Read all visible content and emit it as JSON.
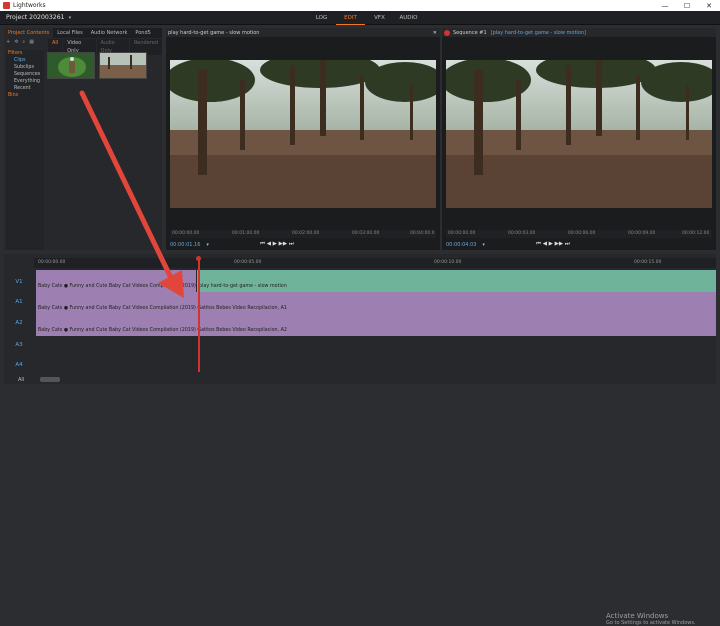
{
  "window": {
    "title": "Lightworks",
    "min": "—",
    "max": "☐",
    "close": "✕"
  },
  "project": {
    "name": "Project 202003261",
    "chevron": "▾"
  },
  "modes": [
    "LOG",
    "EDIT",
    "VFX",
    "AUDIO"
  ],
  "active_mode": "EDIT",
  "left": {
    "tabs": [
      "Project Contents",
      "Local Files",
      "Audio Network",
      "Pond5"
    ],
    "filters": [
      "All",
      "Video Only",
      "Audio Only",
      "Rendered"
    ],
    "tree": {
      "filters_label": "Filters",
      "items": [
        "Clips",
        "Subclips",
        "Sequences",
        "Everything",
        "Recent"
      ],
      "bins_label": "Bins"
    }
  },
  "viewer_left": {
    "title": "play hard-to-get game - slow motion",
    "close": "✕",
    "ruler": [
      "00:00:00.00",
      "00:01:00.00",
      "00:02:00.00",
      "00:03:00.00",
      "00:04:00.0"
    ],
    "timecode": "00:00:01.16",
    "dropdown": "▾"
  },
  "viewer_right": {
    "title": "Sequence #1",
    "subtitle": "[play hard-to-get game - slow motion]",
    "ruler": [
      "00:00:00.00",
      "00:00:03.00",
      "00:00:06.00",
      "00:00:09.00",
      "00:00:12.00"
    ],
    "timecode": "00:00:04.03",
    "dropdown": "▾"
  },
  "transport_glyphs": "⏮ ◀ ▶ ▶▶ ⏭",
  "timeline": {
    "ruler": [
      "00:00:00.00",
      "00:00:05.00",
      "00:00:10.00",
      "00:00:15.00"
    ],
    "tracks": [
      {
        "name": "V1",
        "label": "Baby Cats ● Funny and Cute Baby Cat Videos Compilation (2019) Gatitos B",
        "label2": "play hard-to-get game - slow motion",
        "color": "#9d7fb1",
        "color2": "#6fb39a"
      },
      {
        "name": "A1",
        "label": "Baby Cats ● Funny and Cute Baby Cat Videos Compilation (2019) Gatitos Bebes Video Recopilacion, A1",
        "color": "#9d7fb1"
      },
      {
        "name": "A2",
        "label": "Baby Cats ● Funny and Cute Baby Cat Videos Compilation (2019) Gatitos Bebes Video Recopilacion, A2",
        "color": "#9d7fb1"
      },
      {
        "name": "A3",
        "label": "",
        "color": ""
      },
      {
        "name": "A4",
        "label": "",
        "color": ""
      }
    ],
    "all_button": "All"
  },
  "watermark": {
    "line1": "Activate Windows",
    "line2": "Go to Settings to activate Windows."
  },
  "colors": {
    "accent": "#f07a2a",
    "playhead": "#d0342c",
    "link": "#5ab0f0"
  }
}
